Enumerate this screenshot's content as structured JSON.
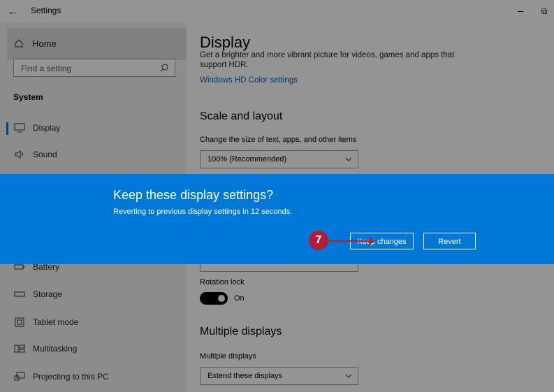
{
  "titlebar": {
    "title": "Settings",
    "back_icon": "←",
    "minimize_icon": "–",
    "restore_icon": "⧉"
  },
  "sidebar": {
    "home_label": "Home",
    "search_placeholder": "Find a setting",
    "section": "System",
    "items": [
      {
        "label": "Display",
        "icon": "monitor-icon"
      },
      {
        "label": "Sound",
        "icon": "speaker-icon"
      },
      {
        "label": "Battery",
        "icon": "battery-icon"
      },
      {
        "label": "Storage",
        "icon": "storage-icon"
      },
      {
        "label": "Tablet mode",
        "icon": "tablet-icon"
      },
      {
        "label": "Multitasking",
        "icon": "multitasking-icon"
      },
      {
        "label": "Projecting to this PC",
        "icon": "project-icon"
      }
    ]
  },
  "main": {
    "title": "Display",
    "hdr_desc": "Get a brighter and more vibrant picture for videos, games and apps that support HDR.",
    "hdr_link": "Windows HD Color settings",
    "scale": {
      "heading": "Scale and layout",
      "label": "Change the size of text, apps, and other items",
      "value": "100% (Recommended)"
    },
    "rotation": {
      "label": "Rotation lock",
      "value": "On"
    },
    "multiple": {
      "heading": "Multiple displays",
      "label": "Multiple displays",
      "value": "Extend these displays"
    }
  },
  "dialog": {
    "title": "Keep these display settings?",
    "message": "Reverting to previous display settings in 12 seconds.",
    "keep_label": "Keep changes",
    "revert_label": "Revert",
    "color": "#0078d7"
  },
  "callout": {
    "number": "7",
    "color": "#b31b3b"
  }
}
